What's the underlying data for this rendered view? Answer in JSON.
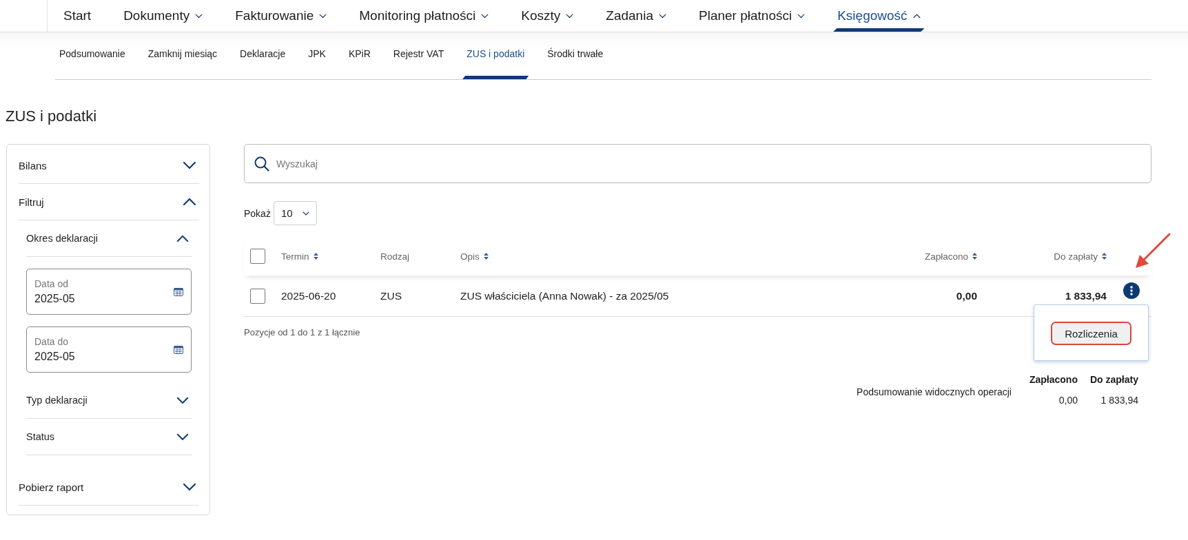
{
  "top_nav": {
    "items": [
      {
        "label": "Start",
        "has_menu": false,
        "selected": false
      },
      {
        "label": "Dokumenty",
        "has_menu": true,
        "expanded": false,
        "selected": false
      },
      {
        "label": "Fakturowanie",
        "has_menu": true,
        "expanded": false,
        "selected": false
      },
      {
        "label": "Monitoring płatności",
        "has_menu": true,
        "expanded": false,
        "selected": false
      },
      {
        "label": "Koszty",
        "has_menu": true,
        "expanded": false,
        "selected": false
      },
      {
        "label": "Zadania",
        "has_menu": true,
        "expanded": false,
        "selected": false
      },
      {
        "label": "Planer płatności",
        "has_menu": true,
        "expanded": false,
        "selected": false
      },
      {
        "label": "Księgowość",
        "has_menu": true,
        "expanded": true,
        "selected": true
      }
    ]
  },
  "sub_nav": {
    "items": [
      {
        "label": "Podsumowanie",
        "selected": false
      },
      {
        "label": "Zamknij miesiąc",
        "selected": false
      },
      {
        "label": "Deklaracje",
        "selected": false
      },
      {
        "label": "JPK",
        "selected": false
      },
      {
        "label": "KPiR",
        "selected": false
      },
      {
        "label": "Rejestr VAT",
        "selected": false
      },
      {
        "label": "ZUS i podatki",
        "selected": true
      },
      {
        "label": "Środki trwałe",
        "selected": false
      }
    ]
  },
  "page_title": "ZUS i podatki",
  "sidebar": {
    "sections": [
      {
        "label": "Bilans",
        "expanded": false
      },
      {
        "label": "Filtruj",
        "expanded": true,
        "children": [
          {
            "label": "Okres deklaracji",
            "expanded": true,
            "fields": [
              {
                "label": "Data od",
                "value": "2025-05"
              },
              {
                "label": "Data do",
                "value": "2025-05"
              }
            ]
          },
          {
            "label": "Typ deklaracji",
            "expanded": false
          },
          {
            "label": "Status",
            "expanded": false
          }
        ]
      },
      {
        "label": "Pobierz raport",
        "expanded": false
      }
    ]
  },
  "search": {
    "placeholder": "Wyszukaj"
  },
  "page_size": {
    "label": "Pokaż",
    "value": "10"
  },
  "table": {
    "header_checked": false,
    "columns": [
      {
        "label": "Termin",
        "sortable": true,
        "kind": "text"
      },
      {
        "label": "Rodzaj",
        "sortable": false,
        "kind": "text"
      },
      {
        "label": "Opis",
        "sortable": true,
        "kind": "text"
      },
      {
        "label": "Zapłacono",
        "sortable": true,
        "kind": "amount"
      },
      {
        "label": "Do zapłaty",
        "sortable": true,
        "kind": "amount"
      }
    ],
    "rows": [
      {
        "checked": false,
        "cells": [
          "2025-06-20",
          "ZUS",
          "ZUS właściciela (Anna Nowak) - za 2025/05",
          "0,00",
          "1 833,94"
        ]
      }
    ],
    "footer": "Pozycje od 1 do 1 z 1 łącznie"
  },
  "row_menu": {
    "items": [
      {
        "label": "Rozliczenia",
        "highlighted": true
      }
    ]
  },
  "annotations": [
    {
      "kind": "arrow"
    }
  ],
  "summary": {
    "label": "Podsumowanie widocznych operacji",
    "columns": [
      "Zapłacono",
      "Do zapłaty"
    ],
    "values": [
      "0,00",
      "1 833,94"
    ]
  }
}
